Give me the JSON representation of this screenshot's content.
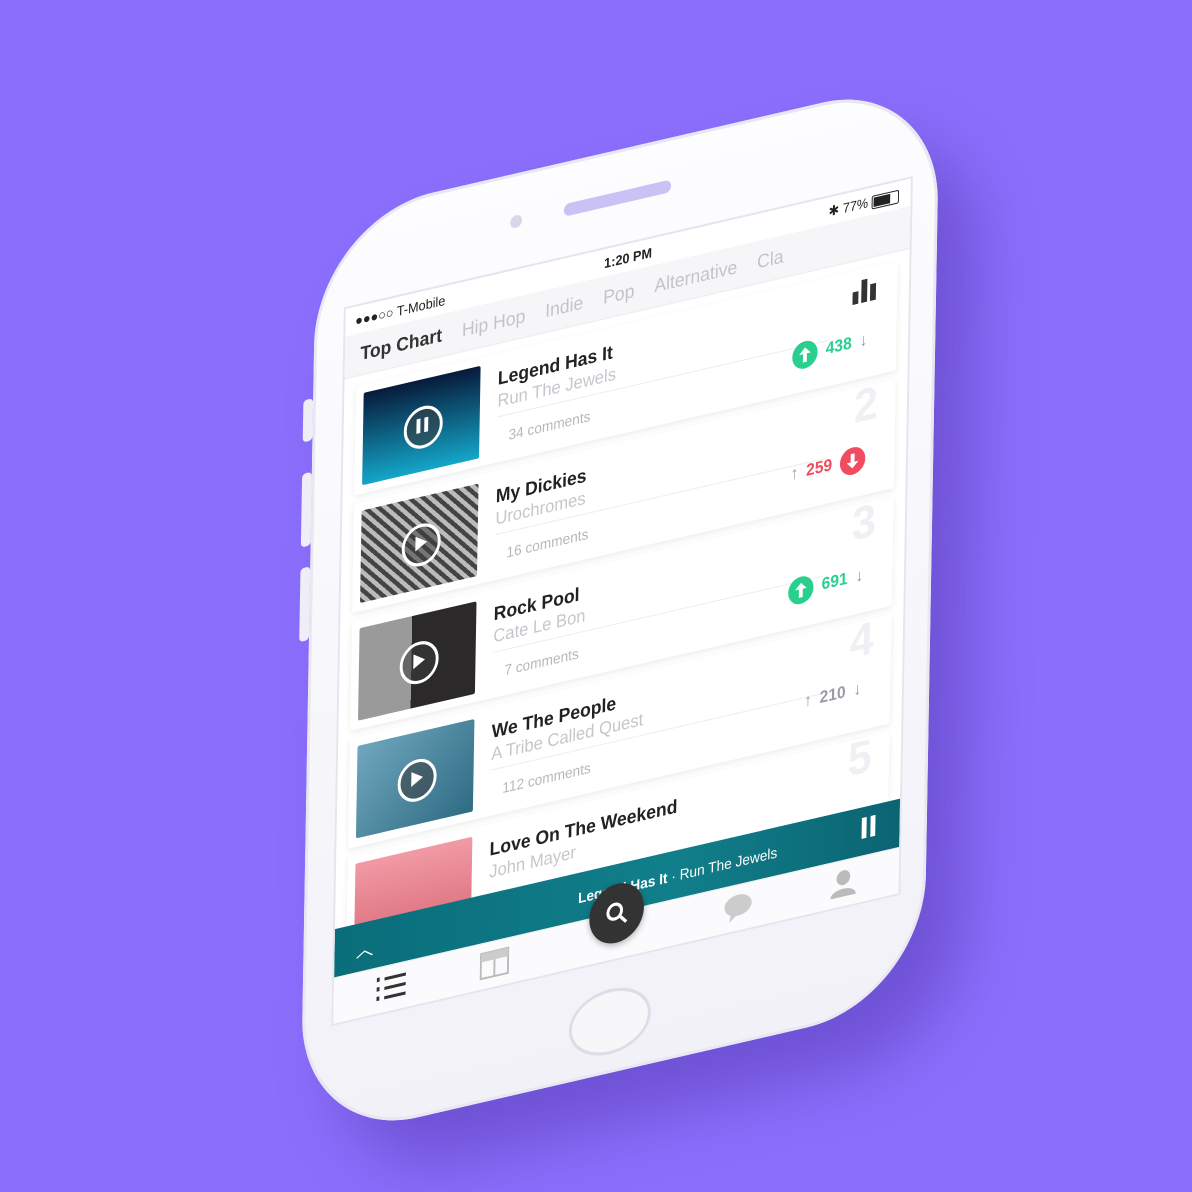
{
  "status": {
    "carrier": "●●●○○ T-Mobile",
    "time": "1:20 PM",
    "battery": "77%",
    "battery_level": 0.77
  },
  "tabs": [
    {
      "label": "Top Chart",
      "active": true
    },
    {
      "label": "Hip Hop",
      "active": false
    },
    {
      "label": "Indie",
      "active": false
    },
    {
      "label": "Pop",
      "active": false
    },
    {
      "label": "Alternative",
      "active": false
    },
    {
      "label": "Cla",
      "active": false
    }
  ],
  "songs": [
    {
      "rank": "",
      "title": "Legend Has It",
      "artist": "Run The Jewels",
      "comments": "34 comments",
      "votes": "438",
      "vote_state": "up",
      "playing": true,
      "cover_color": "#0e5e86"
    },
    {
      "rank": "2",
      "title": "My Dickies",
      "artist": "Urochromes",
      "comments": "16 comments",
      "votes": "259",
      "vote_state": "down",
      "playing": false,
      "cover_color": "#6b6b6b"
    },
    {
      "rank": "3",
      "title": "Rock Pool",
      "artist": "Cate Le Bon",
      "comments": "7 comments",
      "votes": "691",
      "vote_state": "up",
      "playing": false,
      "cover_color": "#2d2b2b"
    },
    {
      "rank": "4",
      "title": "We The People",
      "artist": "A Tribe Called Quest",
      "comments": "112 comments",
      "votes": "210",
      "vote_state": "none",
      "playing": false,
      "cover_color": "#3f7d95"
    },
    {
      "rank": "5",
      "title": "Love On The Weekend",
      "artist": "John Mayer",
      "comments": "",
      "votes": "",
      "vote_state": "none",
      "playing": false,
      "cover_color": "#e98b96"
    }
  ],
  "now_playing": {
    "title": "Legend Has It",
    "separator": "·",
    "artist": "Run The Jewels"
  },
  "colors": {
    "background": "#8b6ffc",
    "upvote": "#29d08d",
    "downvote": "#f04b5e",
    "player": "#0a6d7a"
  }
}
